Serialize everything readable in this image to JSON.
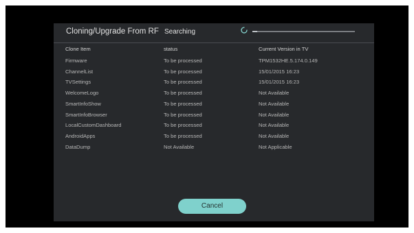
{
  "dialog": {
    "title": "Cloning/Upgrade From RF",
    "status_text": "Searching",
    "progress_fraction": 0.05
  },
  "table": {
    "headers": [
      "Clone Item",
      "status",
      "Current Version in TV"
    ],
    "rows": [
      [
        "Firmware",
        "To be processed",
        "TPM1532HE.5.174.0.149"
      ],
      [
        "ChannelList",
        "To be processed",
        "15/01/2015 16:23"
      ],
      [
        "TVSettings",
        "To be processed",
        "15/01/2015 16:23"
      ],
      [
        "WelcomeLogo",
        "To be processed",
        "Not Available"
      ],
      [
        "SmartInfoShow",
        "To be processed",
        "Not Available"
      ],
      [
        "SmartInfoBrowser",
        "To be processed",
        "Not Available"
      ],
      [
        "LocalCustomDashboard",
        "To be processed",
        "Not Available"
      ],
      [
        "AndroidApps",
        "To be processed",
        "Not Available"
      ],
      [
        "DataDump",
        "Not Available",
        "Not Applicable"
      ]
    ]
  },
  "buttons": {
    "cancel_label": "Cancel"
  },
  "icons": {
    "spinner": "loading-spinner-icon"
  },
  "colors": {
    "dialog_background": "#27292c",
    "accent": "#7fd1cc"
  }
}
